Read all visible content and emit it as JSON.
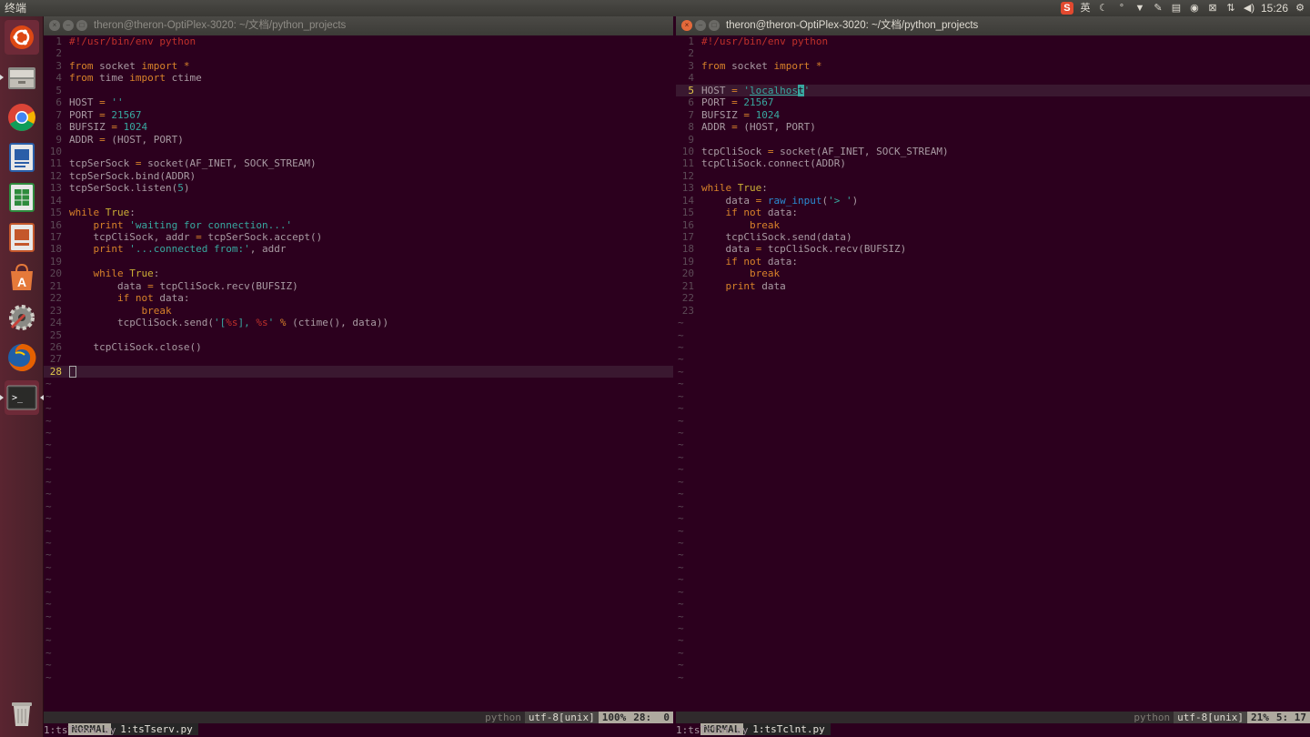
{
  "topbar": {
    "app_title": "终端",
    "tray_input_lang": "英",
    "clock": "15:26"
  },
  "launcher": {
    "items": [
      "ubuntu-dash",
      "files",
      "chrome",
      "libreoffice-writer",
      "libreoffice-calc",
      "libreoffice-impress",
      "software-center",
      "system-settings",
      "firefox",
      "terminal",
      "trash"
    ]
  },
  "left_window": {
    "title": "theron@theron-OptiPlex-3020: ~/文档/python_projects",
    "status": {
      "mode": "NORMAL",
      "buffer": "1:tsTserv.py",
      "filetype": "python",
      "encoding": "utf-8[unix]",
      "percent": "100%",
      "position": "28:  0"
    },
    "cmdline": "1:tsTserv.py",
    "lines": [
      "#!/usr/bin/env python",
      "",
      "from socket import *",
      "from time import ctime",
      "",
      "HOST = ''",
      "PORT = 21567",
      "BUFSIZ = 1024",
      "ADDR = (HOST, PORT)",
      "",
      "tcpSerSock = socket(AF_INET, SOCK_STREAM)",
      "tcpSerSock.bind(ADDR)",
      "tcpSerSock.listen(5)",
      "",
      "while True:",
      "    print 'waiting for connection...'",
      "    tcpCliSock, addr = tcpSerSock.accept()",
      "    print '...connected from:', addr",
      "",
      "    while True:",
      "        data = tcpCliSock.recv(BUFSIZ)",
      "        if not data:",
      "            break",
      "        tcpCliSock.send('[%s], %s' % (ctime(), data))",
      "",
      "    tcpCliSock.close()",
      "",
      ""
    ]
  },
  "right_window": {
    "title": "theron@theron-OptiPlex-3020: ~/文档/python_projects",
    "status": {
      "mode": "NORMAL",
      "buffer": "1:tsTclnt.py",
      "filetype": "python",
      "encoding": "utf-8[unix]",
      "percent": "21%",
      "position": "5: 17"
    },
    "cmdline": "1:tsTclnt.py",
    "lines": [
      "#!/usr/bin/env python",
      "",
      "from socket import *",
      "",
      "HOST = 'localhost'",
      "PORT = 21567",
      "BUFSIZ = 1024",
      "ADDR = (HOST, PORT)",
      "",
      "tcpCliSock = socket(AF_INET, SOCK_STREAM)",
      "tcpCliSock.connect(ADDR)",
      "",
      "while True:",
      "    data = raw_input('> ')",
      "    if not data:",
      "        break",
      "    tcpCliSock.send(data)",
      "    data = tcpCliSock.recv(BUFSIZ)",
      "    if not data:",
      "        break",
      "    print data",
      "",
      ""
    ]
  },
  "colors": {
    "background": "#2c001e",
    "keyword": "#d8822a",
    "string": "#38a8a0",
    "comment": "#c0302b",
    "function": "#2a8bd1"
  }
}
